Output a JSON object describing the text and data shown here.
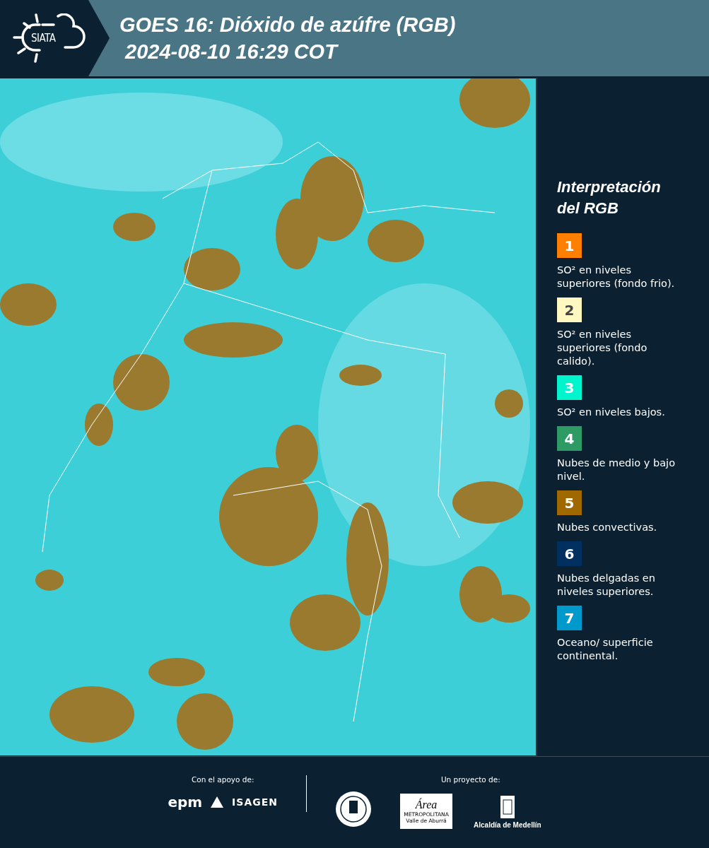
{
  "header": {
    "logo_text": "SIATA",
    "title": "GOES 16: Dióxido de azúfre (RGB)",
    "subtitle": "2024-08-10 16:29 COT"
  },
  "legend": {
    "title": "Interpretación del RGB",
    "items": [
      {
        "number": "1",
        "color": "#ff7f00",
        "text": "SO² en niveles superiores (fondo frio)."
      },
      {
        "number": "2",
        "color": "#fff8c0",
        "text": "SO² en niveles superiores (fondo calido)."
      },
      {
        "number": "3",
        "color": "#00f5cc",
        "text": "SO² en niveles bajos."
      },
      {
        "number": "4",
        "color": "#2e9a64",
        "text": "Nubes de medio y bajo nivel."
      },
      {
        "number": "5",
        "color": "#a06800",
        "text": "Nubes convectivas."
      },
      {
        "number": "6",
        "color": "#003060",
        "text": "Nubes delgadas en niveles superiores."
      },
      {
        "number": "7",
        "color": "#0099cc",
        "text": "Oceano/ superficie continental."
      }
    ]
  },
  "footer": {
    "support_label": "Con el apoyo de:",
    "project_label": "Un proyecto de:",
    "epm": "epm",
    "isagen": "ISAGEN",
    "area": "Área",
    "area_sub1": "METROPOLITANA",
    "area_sub2": "Valle de Aburrá",
    "alcaldia": "Alcaldía de Medellín"
  }
}
